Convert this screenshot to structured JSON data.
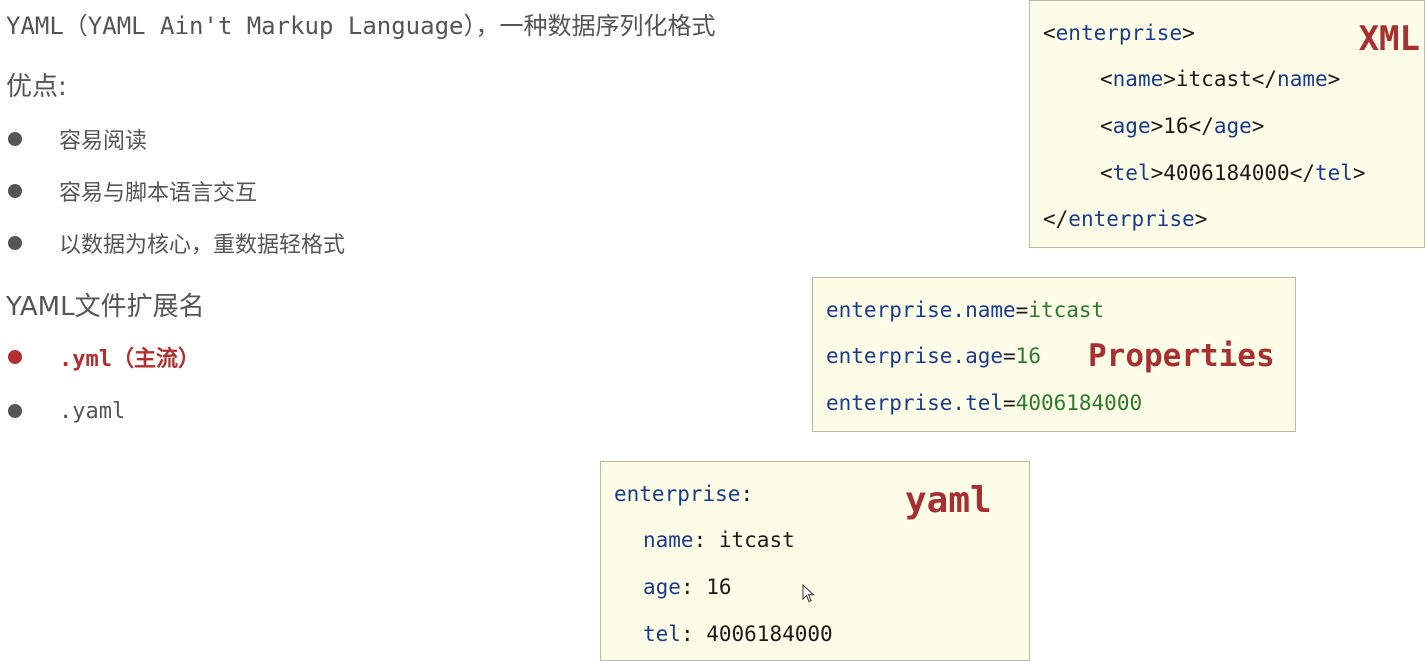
{
  "title": "YAML（YAML Ain't Markup Language），一种数据序列化格式",
  "advantages": {
    "heading": "优点:",
    "items": [
      "容易阅读",
      "容易与脚本语言交互",
      "以数据为核心，重数据轻格式"
    ]
  },
  "extensions": {
    "heading": "YAML文件扩展名",
    "items": [
      {
        "text": ".yml（主流）",
        "highlight": true
      },
      {
        "text": ".yaml",
        "highlight": false
      }
    ]
  },
  "xml_box": {
    "label": "XML",
    "root_tag": "enterprise",
    "fields": [
      {
        "tag": "name",
        "value": "itcast"
      },
      {
        "tag": "age",
        "value": "16"
      },
      {
        "tag": "tel",
        "value": "4006184000"
      }
    ]
  },
  "properties_box": {
    "label": "Properties",
    "lines": [
      {
        "key": "enterprise.name",
        "value": "itcast"
      },
      {
        "key": "enterprise.age",
        "value": "16"
      },
      {
        "key": "enterprise.tel",
        "value": "4006184000"
      }
    ]
  },
  "yaml_box": {
    "label": "yaml",
    "root_key": "enterprise",
    "fields": [
      {
        "key": "name",
        "value": "itcast"
      },
      {
        "key": "age",
        "value": "16"
      },
      {
        "key": "tel",
        "value": "4006184000"
      }
    ]
  },
  "colors": {
    "accent_red": "#a83030",
    "code_bg": "#fefee8",
    "tag_blue": "#1a3a8c",
    "value_green": "#2c7a2c"
  }
}
